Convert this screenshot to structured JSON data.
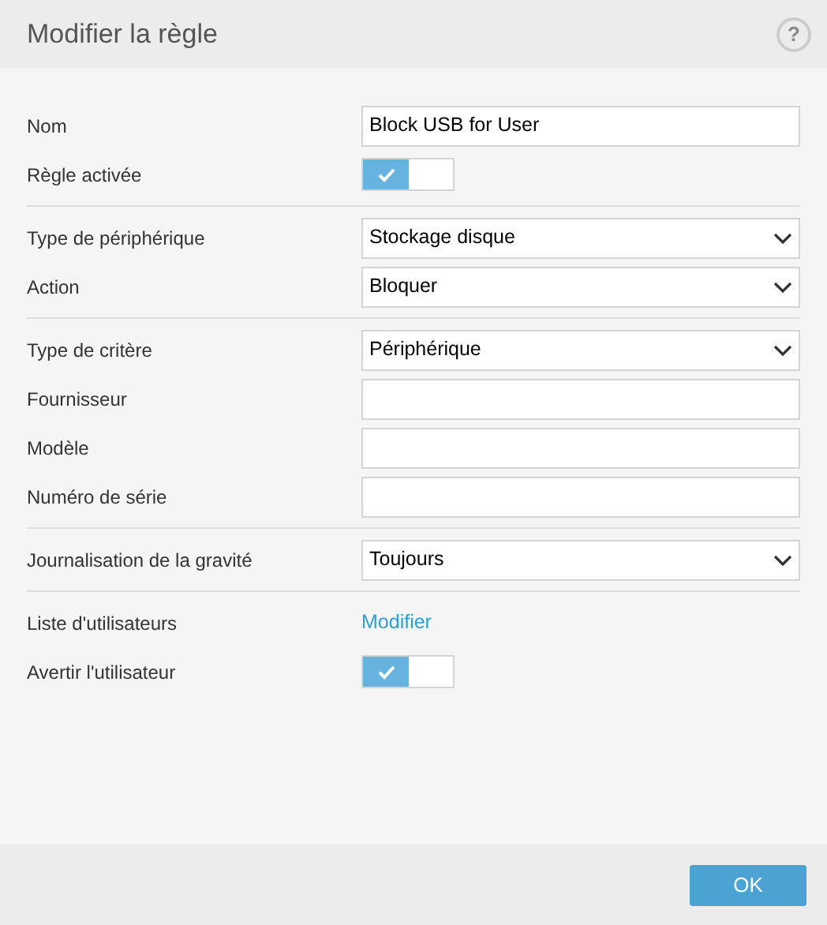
{
  "window": {
    "title": "Modifier la règle",
    "help": "?"
  },
  "sections": [
    {
      "rows": [
        {
          "label": "Nom",
          "kind": "text",
          "value": "Block USB for User"
        },
        {
          "label": "Règle activée",
          "kind": "toggle",
          "on": true
        }
      ]
    },
    {
      "rows": [
        {
          "label": "Type de périphérique",
          "kind": "select",
          "value": "Stockage disque"
        },
        {
          "label": "Action",
          "kind": "select",
          "value": "Bloquer"
        }
      ]
    },
    {
      "rows": [
        {
          "label": "Type de critère",
          "kind": "select",
          "value": "Périphérique"
        },
        {
          "label": "Fournisseur",
          "kind": "text"
        },
        {
          "label": "Modèle",
          "kind": "text"
        },
        {
          "label": "Numéro de série",
          "kind": "text"
        }
      ]
    },
    {
      "rows": [
        {
          "label": "Journalisation de la gravité",
          "kind": "select",
          "value": "Toujours"
        }
      ]
    },
    {
      "rows": [
        {
          "label": "Liste d'utilisateurs",
          "kind": "link",
          "value": "Modifier"
        },
        {
          "label": "Avertir l'utilisateur",
          "kind": "toggle",
          "on": true
        }
      ]
    }
  ],
  "buttons": [
    "OK"
  ]
}
